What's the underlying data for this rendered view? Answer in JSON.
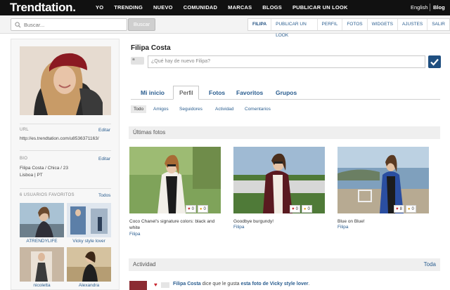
{
  "topbar": {
    "logo": "Trendtation.",
    "nav": [
      "YO",
      "TRENDING",
      "NUEVO",
      "COMUNIDAD",
      "MARCAS",
      "BLOGS",
      "PUBLICAR UN LOOK"
    ],
    "language": "English",
    "blog": "Blog"
  },
  "searchbar": {
    "placeholder": "Buscar...",
    "button": "Buscar",
    "subnav": [
      "FILIPA",
      "PUBLICAR UN LOOK",
      "PERFIL",
      "FOTOS",
      "WIDGETS",
      "AJUSTES",
      "SALIR"
    ]
  },
  "sidebar": {
    "url_label": "URL",
    "url_edit": "Editar",
    "url_value": "http://es.trendtation.com/u8536371163/",
    "bio_label": "BIO",
    "bio_edit": "Editar",
    "bio_line1": "Filipa Costa / Chica / 23",
    "bio_line2": "Lisboa | PT",
    "favs_label": "6 USUARIOS FAVORITOS",
    "favs_all": "Todos",
    "favorites": [
      "ATRENDYLIFE",
      "Vicky style lover",
      "nicoletta",
      "Alexandra"
    ]
  },
  "profile": {
    "name": "Filipa Costa",
    "quote": "“",
    "status_placeholder": "¿Qué hay de nuevo Filipa?"
  },
  "tabs": [
    "Mi inicio",
    "Perfil",
    "Fotos",
    "Favoritos",
    "Grupos"
  ],
  "subtabs": [
    "Todo",
    "Amigos",
    "Seguidores",
    "Actividad",
    "Comentarios"
  ],
  "photos_section": {
    "title": "Últimas fotos",
    "items": [
      {
        "caption": "Coco Chanel's signature colors: black and white",
        "user": "Filipa",
        "hearts": "0",
        "comments": "0"
      },
      {
        "caption": "Goodbye burgundy!",
        "user": "Filipa",
        "hearts": "0",
        "comments": "0"
      },
      {
        "caption": "Blue on Blue!",
        "user": "Filipa",
        "hearts": "8",
        "comments": "0"
      }
    ]
  },
  "activity_section": {
    "title": "Actividad",
    "all": "Toda",
    "row_user": "Filipa Costa",
    "row_text1": " dice que le gusta ",
    "row_link": "esta foto de Vicky style lover",
    "row_end": "."
  },
  "colors": {
    "brand_dark": "#111111",
    "link_blue": "#2a5d8f",
    "heart_red": "#c8232c"
  }
}
